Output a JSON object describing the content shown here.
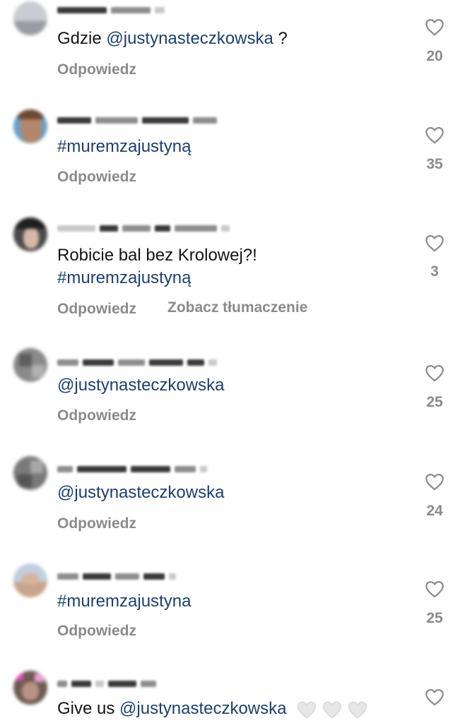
{
  "comments": [
    {
      "text_plain": "Gdzie ",
      "mention": "@justynasteczkowska",
      "text_after": " ?",
      "reply": "Odpowiedz",
      "likes": "20"
    },
    {
      "hashtag": "#muremzajustyną",
      "reply": "Odpowiedz",
      "likes": "35"
    },
    {
      "text_plain": "Robicie bal bez Krolowej?!",
      "hashtag": "#muremzajustyną",
      "reply": "Odpowiedz",
      "translate": "Zobacz tłumaczenie",
      "likes": "3"
    },
    {
      "mention": "@justynasteczkowska",
      "reply": "Odpowiedz",
      "likes": "25"
    },
    {
      "mention": "@justynasteczkowska",
      "reply": "Odpowiedz",
      "likes": "24"
    },
    {
      "hashtag": "#muremzajustyna",
      "reply": "Odpowiedz",
      "likes": "25"
    },
    {
      "text_plain": "Give us ",
      "mention": "@justynasteczkowska",
      "emoji_icons": [
        "white-heart-icon",
        "white-heart-icon",
        "white-heart-icon"
      ]
    }
  ],
  "colors": {
    "tag": "#1c3f72",
    "muted": "#8b8b8b",
    "text": "#141414"
  }
}
